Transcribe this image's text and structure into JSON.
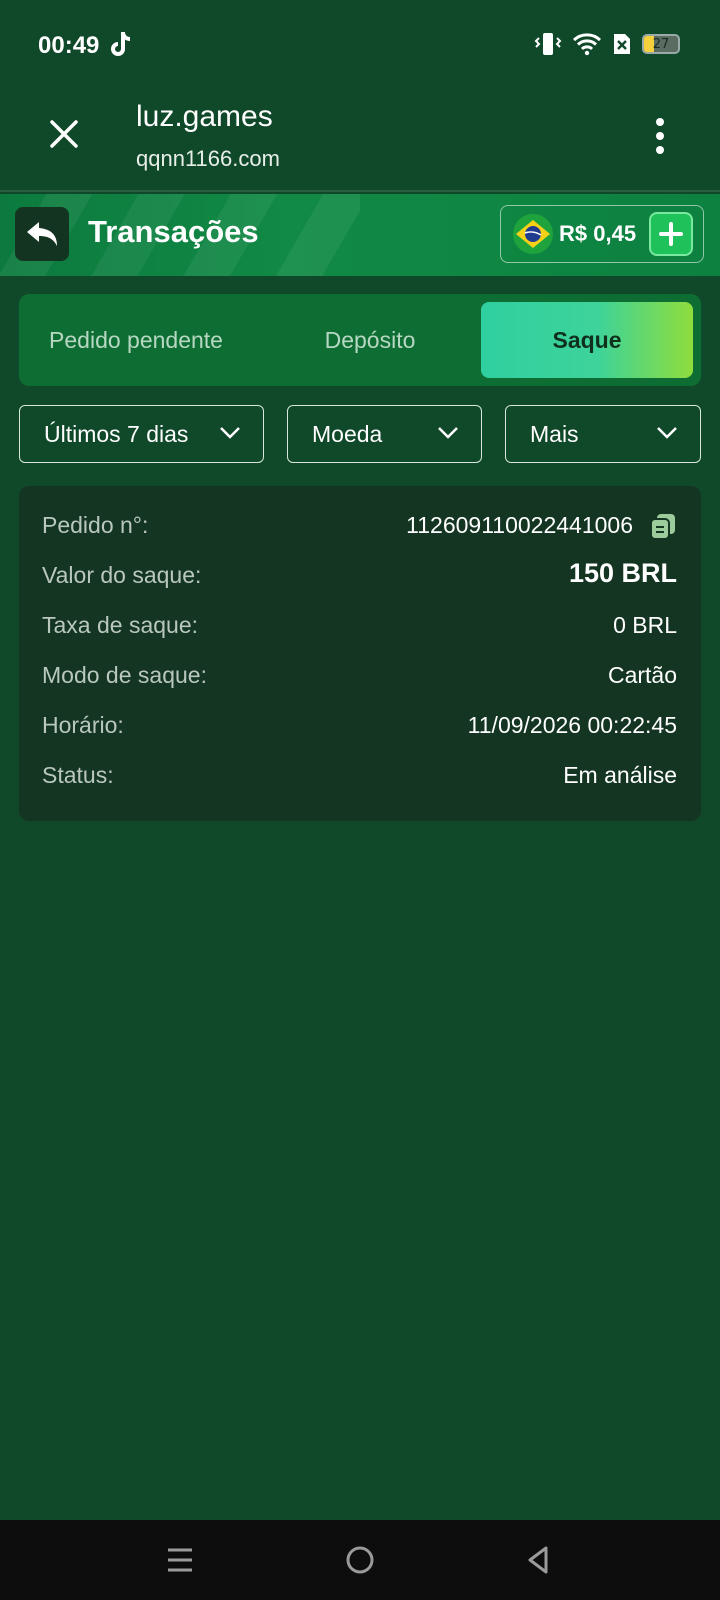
{
  "status_bar": {
    "time": "00:49",
    "battery_level": "27",
    "icons": [
      "tiktok-icon",
      "vibrate-icon",
      "wifi-icon",
      "no-sim-icon",
      "battery-icon"
    ]
  },
  "browser_bar": {
    "title": "luz.games",
    "url": "qqnn1166.com"
  },
  "header": {
    "title": "Transações",
    "balance": "R$ 0,45"
  },
  "tabs": [
    {
      "label": "Pedido pendente",
      "active": false
    },
    {
      "label": "Depósito",
      "active": false
    },
    {
      "label": "Saque",
      "active": true
    }
  ],
  "filters": {
    "period": "Últimos 7 dias",
    "currency": "Moeda",
    "more": "Mais"
  },
  "transaction": {
    "order_label": "Pedido n°:",
    "order_value": "112609110022441006",
    "amount_label": "Valor do saque:",
    "amount_value": "150 BRL",
    "fee_label": "Taxa de saque:",
    "fee_value": "0 BRL",
    "mode_label": "Modo de saque:",
    "mode_value": "Cartão",
    "time_label": "Horário:",
    "time_value": "11/09/2026 00:22:45",
    "status_label": "Status:",
    "status_value": "Em análise"
  },
  "colors": {
    "background": "#10482a",
    "header": "#0c7a3e",
    "card": "#133522",
    "active_tab_start": "#2fcfa0",
    "active_tab_end": "#8fdd3c"
  }
}
